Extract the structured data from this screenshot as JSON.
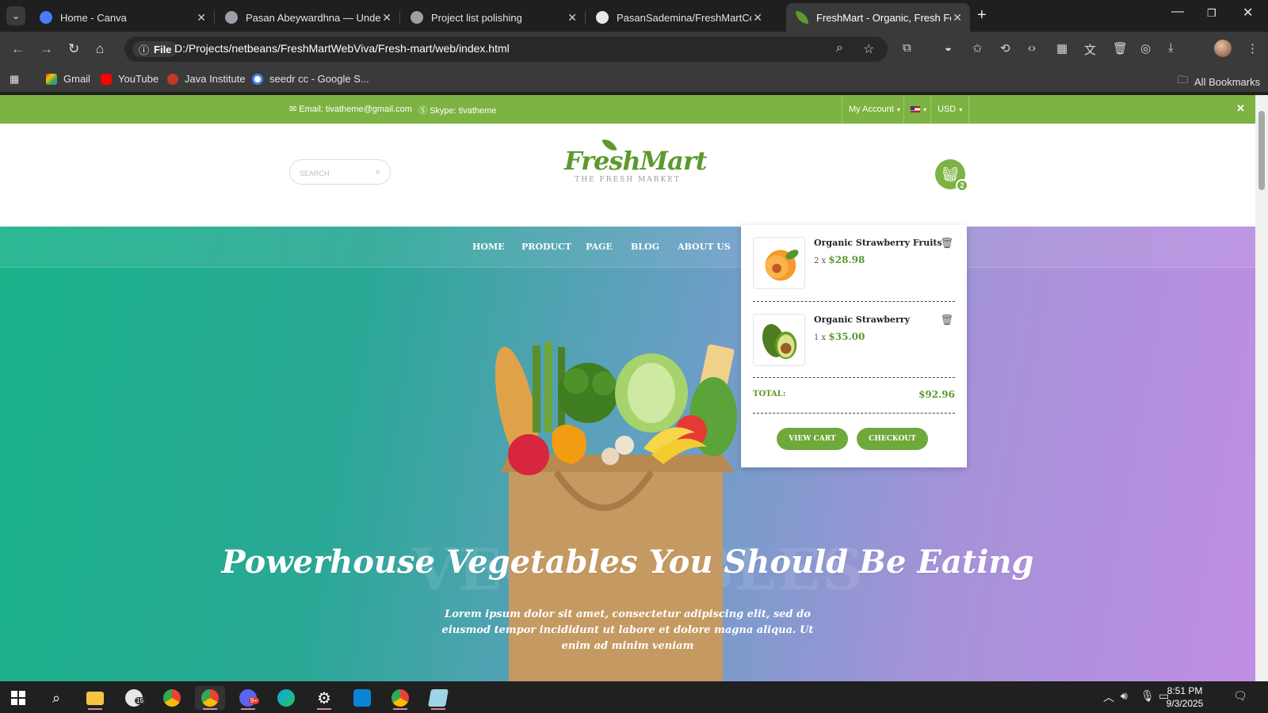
{
  "browser": {
    "tabs": [
      {
        "title": "Home - Canva",
        "favicon_color": "#4a7bff"
      },
      {
        "title": "Pasan Abeywardhna — Undergraduate",
        "favicon_color": "#9aa0a6"
      },
      {
        "title": "Project list polishing",
        "favicon_color": "#9aa0a6"
      },
      {
        "title": "PasanSademina/FreshMartCom",
        "favicon_color": "#e8e8e8"
      },
      {
        "title": "FreshMart - Organic, Fresh Food",
        "favicon_color": "#5c9a2f",
        "active": true
      }
    ],
    "address_label": "File",
    "url": "D:/Projects/netbeans/FreshMartWebViva/Fresh-mart/web/index.html",
    "bookmarks": [
      "Gmail",
      "YouTube",
      "Java Institute",
      "seedr cc - Google S..."
    ],
    "all_bookmarks_label": "All Bookmarks"
  },
  "site": {
    "topbar": {
      "email": "Email: tivatheme@gmail.com",
      "skype": "Skype: tivatheme",
      "account": "My Account",
      "currency": "USD",
      "close": "✕"
    },
    "search_placeholder": "SEARCH",
    "logo": {
      "name": "FreshMart",
      "tagline": "THE FRESH MARKET"
    },
    "cart_count": "2",
    "nav": [
      "HOME",
      "PRODUCT",
      "PAGE",
      "BLOG",
      "ABOUT US"
    ],
    "hero": {
      "background_word": "VEGETABLES",
      "title": "Powerhouse Vegetables You Should Be Eating",
      "text": "Lorem ipsum dolor sit amet, consectetur adipiscing elit, sed do eiusmod tempor incididunt ut labore et dolore magna aliqua. Ut enim ad minim veniam"
    },
    "cart_dropdown": {
      "items": [
        {
          "name": "Organic Strawberry Fruits",
          "qty": "2 x",
          "price": "$28.98",
          "image": "apricot"
        },
        {
          "name": "Organic Strawberry",
          "qty": "1 x",
          "price": "$35.00",
          "image": "avocado"
        }
      ],
      "total_label": "TOTAL:",
      "total_value": "$92.96",
      "view_cart": "VIEW CART",
      "checkout": "CHECKOUT"
    },
    "colors": {
      "brand_green": "#7cb342",
      "hero_start": "#1ab38a",
      "hero_end": "#c08ee4"
    }
  },
  "taskbar": {
    "time": "8:51 PM",
    "date": "9/3/2025",
    "badges": [
      "15",
      "9+"
    ]
  }
}
